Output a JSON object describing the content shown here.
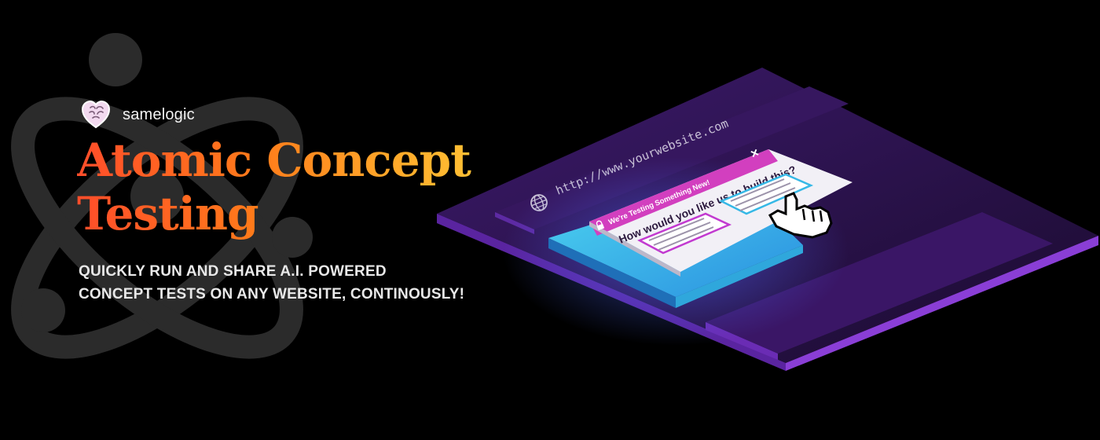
{
  "brand": {
    "name": "samelogic",
    "logo_icon": "heart-brain-icon"
  },
  "hero": {
    "title_line1": "Atomic Concept",
    "title_line2": "Testing",
    "subtitle_line1": "QUICKLY RUN AND SHARE A.I. POWERED",
    "subtitle_line2": "CONCEPT TESTS ON ANY WEBSITE, CONTINOUSLY!"
  },
  "illustration": {
    "url_text": "http://www.yourwebsite.com",
    "popup_header": "We're Testing Something New!",
    "popup_question": "How would you like us to build this?",
    "close_label": "×",
    "icons": [
      "globe-icon",
      "lock-icon",
      "close-icon",
      "pointer-hand-icon",
      "atom-icon"
    ]
  },
  "colors": {
    "background": "#000000",
    "title_gradient_start": "#ff4d2a",
    "title_gradient_end": "#ffcc3a",
    "subtitle": "#e8e8e8",
    "platform_purple": "#4a1f7a",
    "popup_header_magenta": "#d23fbf",
    "card_cyan": "#39c5e6"
  }
}
